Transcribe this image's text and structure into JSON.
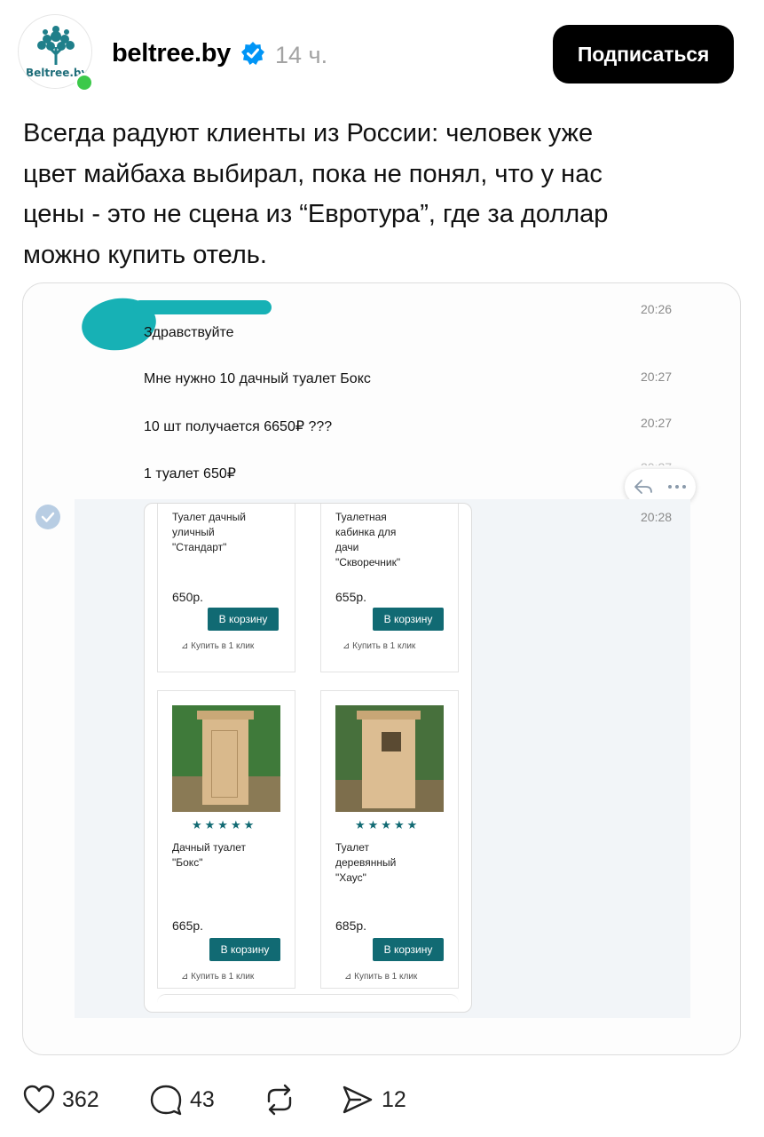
{
  "post": {
    "avatar_text": "Beltree.by",
    "username": "beltree.by",
    "time": "14 ч.",
    "subscribe_label": "Подписаться",
    "text_lines": [
      "Всегда радуют клиенты из России: человек уже",
      "цвет майбаха выбирал, пока не понял, что у нас",
      "цены - это не сцена из “Евротура”, где за доллар",
      "можно купить отель."
    ]
  },
  "screenshot": {
    "messages": [
      {
        "text": "Здравствуйте",
        "time": "20:26"
      },
      {
        "text": "Мне нужно 10 дачный туалет Бокс",
        "time": "20:27"
      },
      {
        "text": "10 шт получается 6650₽  ???",
        "time": "20:27"
      },
      {
        "text": "1 туалет 650₽",
        "time": "20:27"
      },
      {
        "text": "",
        "time": "20:28"
      }
    ],
    "products": [
      {
        "name_lines": [
          "Туалет дачный",
          "уличный",
          "\"Стандарт\""
        ],
        "price": "650р.",
        "cart": "В корзину",
        "buy": "Купить в 1 клик"
      },
      {
        "name_lines": [
          "Туалетная",
          "кабинка для",
          "дачи",
          "\"Скворечник\""
        ],
        "price": "655р.",
        "cart": "В корзину",
        "buy": "Купить в 1 клик"
      },
      {
        "name_lines": [
          "Дачный туалет",
          "\"Бокс\""
        ],
        "price": "665р.",
        "cart": "В корзину",
        "buy": "Купить в 1 клик",
        "stars": "★★★★★",
        "rating": 5
      },
      {
        "name_lines": [
          "Туалет",
          "деревянный",
          "\"Хаус\""
        ],
        "price": "685р.",
        "cart": "В корзину",
        "buy": "Купить в 1 клик",
        "stars": "★★★★★",
        "rating": 5
      }
    ]
  },
  "actions": {
    "likes": "362",
    "comments": "43",
    "shares": "12"
  },
  "colors": {
    "accent_teal": "#116a73",
    "verified_blue": "#0095f6",
    "online_green": "#3cc94a",
    "blob_teal": "#17b1b5"
  },
  "icons": [
    "heart-icon",
    "comment-icon",
    "repost-icon",
    "send-icon",
    "verified-icon",
    "reply-icon",
    "more-icon",
    "check-icon"
  ]
}
